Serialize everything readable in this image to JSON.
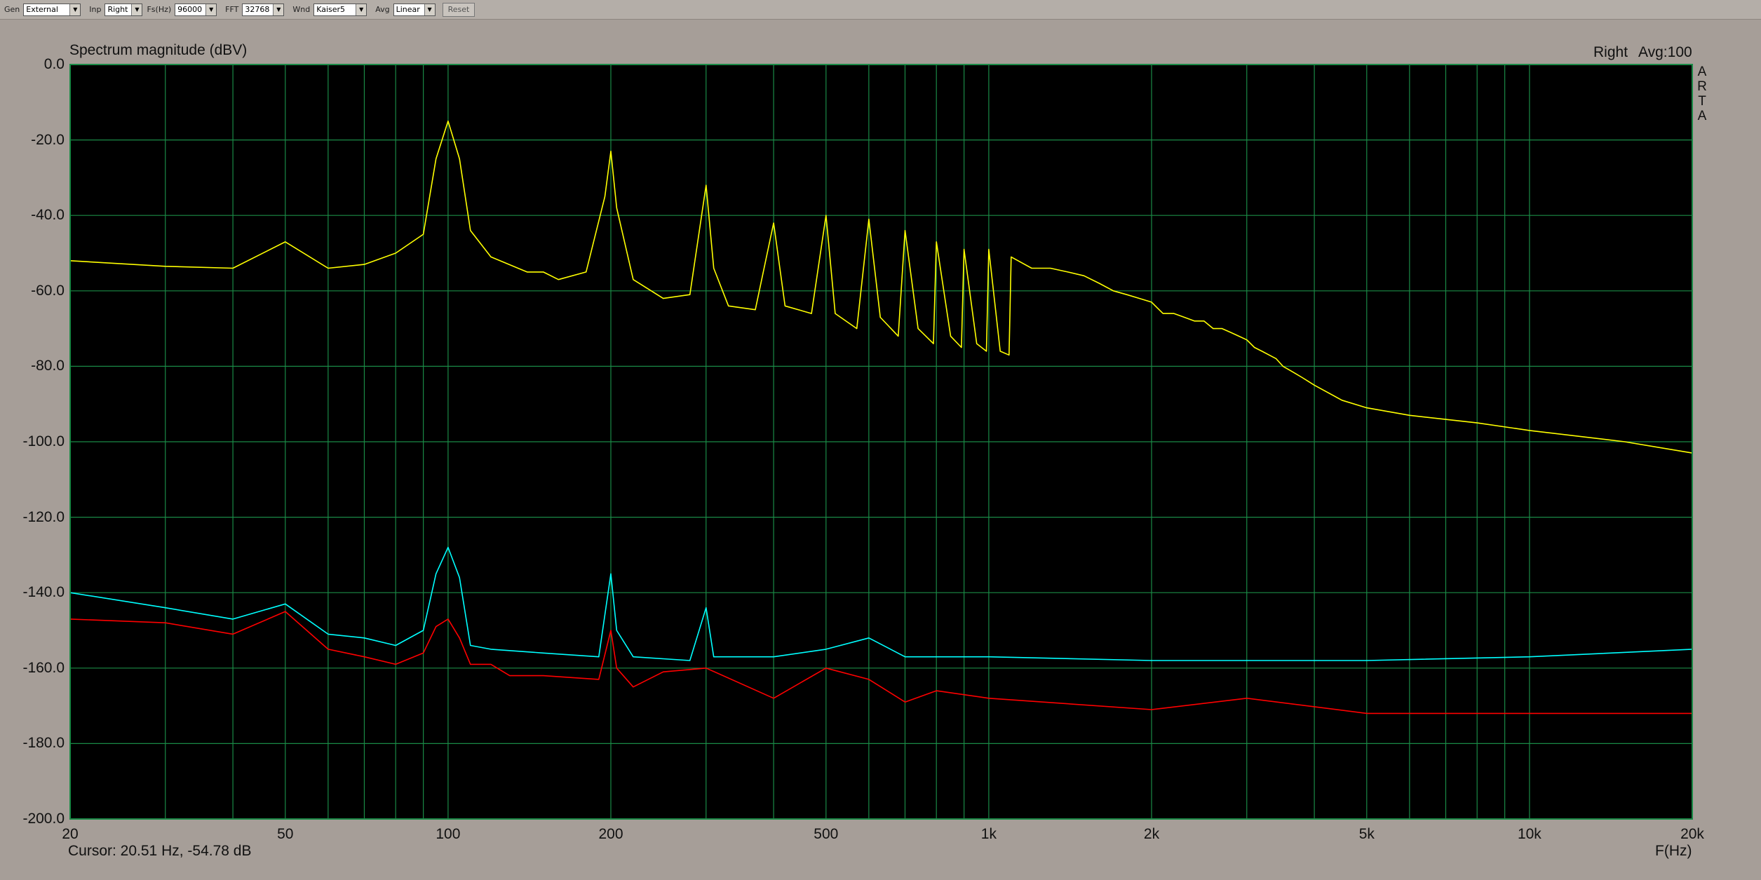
{
  "toolbar": {
    "gen": {
      "label": "Gen",
      "value": "External"
    },
    "inp": {
      "label": "Inp",
      "value": "Right"
    },
    "fs": {
      "label": "Fs(Hz)",
      "value": "96000"
    },
    "fft": {
      "label": "FFT",
      "value": "32768"
    },
    "wnd": {
      "label": "Wnd",
      "value": "Kaiser5"
    },
    "avg": {
      "label": "Avg",
      "value": "Linear"
    },
    "reset_label": "Reset"
  },
  "header": {
    "channel": "Right",
    "avg": "Avg:100",
    "watermark": [
      "A",
      "R",
      "T",
      "A"
    ]
  },
  "cursor_readout": "Cursor: 20.51 Hz, -54.78 dB",
  "colors": {
    "background": "#000000",
    "grid": "#1a8a46",
    "series1": "#ffff00",
    "series2": "#00ffff",
    "series3": "#ff0000"
  },
  "chart_data": {
    "type": "line",
    "title": "Spectrum magnitude (dBV)",
    "xlabel": "F(Hz)",
    "ylabel": "",
    "xscale": "log",
    "xlim": [
      20,
      20000
    ],
    "ylim": [
      -200,
      0
    ],
    "grid": true,
    "x_ticks": [
      20,
      50,
      100,
      200,
      500,
      1000,
      2000,
      5000,
      10000,
      20000
    ],
    "x_tick_labels": [
      "20",
      "50",
      "100",
      "200",
      "500",
      "1k",
      "2k",
      "5k",
      "10k",
      "20k"
    ],
    "y_ticks": [
      0,
      -20,
      -40,
      -60,
      -80,
      -100,
      -120,
      -140,
      -160,
      -180,
      -200
    ],
    "y_tick_labels": [
      "0.0",
      "-20.0",
      "-40.0",
      "-60.0",
      "-80.0",
      "-100.0",
      "-120.0",
      "-140.0",
      "-160.0",
      "-180.0",
      "-200.0"
    ],
    "series": [
      {
        "color": "#ffff00",
        "x": [
          20,
          30,
          40,
          50,
          60,
          70,
          80,
          90,
          95,
          100,
          105,
          110,
          120,
          140,
          150,
          160,
          180,
          195,
          200,
          205,
          220,
          250,
          280,
          300,
          310,
          330,
          370,
          400,
          420,
          470,
          500,
          520,
          570,
          600,
          630,
          680,
          700,
          740,
          790,
          800,
          850,
          890,
          900,
          950,
          990,
          1000,
          1050,
          1090,
          1100,
          1200,
          1300,
          1400,
          1500,
          1600,
          1700,
          1800,
          1900,
          2000,
          2100,
          2200,
          2300,
          2400,
          2500,
          2600,
          2700,
          2800,
          2900,
          3000,
          3100,
          3200,
          3300,
          3400,
          3500,
          3600,
          3700,
          3800,
          3900,
          4000,
          4500,
          5000,
          6000,
          8000,
          10000,
          15000,
          20000
        ],
        "y": [
          -52,
          -53.5,
          -54,
          -47,
          -54,
          -53,
          -50,
          -45,
          -25,
          -15,
          -25,
          -44,
          -51,
          -55,
          -55,
          -57,
          -55,
          -35,
          -23,
          -38,
          -57,
          -62,
          -61,
          -32,
          -54,
          -64,
          -65,
          -42,
          -64,
          -66,
          -40,
          -66,
          -70,
          -41,
          -67,
          -72,
          -44,
          -70,
          -74,
          -47,
          -72,
          -75,
          -49,
          -74,
          -76,
          -49,
          -76,
          -77,
          -51,
          -54,
          -54,
          -55,
          -56,
          -58,
          -60,
          -61,
          -62,
          -63,
          -66,
          -66,
          -67,
          -68,
          -68,
          -70,
          -70,
          -71,
          -72,
          -73,
          -75,
          -76,
          -77,
          -78,
          -80,
          -81,
          -82,
          -83,
          -84,
          -85,
          -89,
          -91,
          -93,
          -95,
          -97,
          -100,
          -103
        ]
      },
      {
        "color": "#00ffff",
        "x": [
          20,
          30,
          40,
          50,
          60,
          70,
          80,
          90,
          95,
          100,
          105,
          110,
          120,
          150,
          190,
          200,
          205,
          220,
          280,
          300,
          310,
          400,
          500,
          600,
          700,
          800,
          1000,
          2000,
          5000,
          10000,
          20000
        ],
        "y": [
          -140,
          -144,
          -147,
          -143,
          -151,
          -152,
          -154,
          -150,
          -135,
          -128,
          -136,
          -154,
          -155,
          -156,
          -157,
          -135,
          -150,
          -157,
          -158,
          -144,
          -157,
          -157,
          -155,
          -152,
          -157,
          -157,
          -157,
          -158,
          -158,
          -157,
          -155
        ]
      },
      {
        "color": "#ff0000",
        "x": [
          20,
          30,
          40,
          50,
          60,
          70,
          80,
          90,
          95,
          100,
          105,
          110,
          120,
          130,
          150,
          190,
          200,
          205,
          220,
          250,
          300,
          400,
          500,
          600,
          700,
          800,
          1000,
          2000,
          3000,
          5000,
          10000,
          20000
        ],
        "y": [
          -147,
          -148,
          -151,
          -145,
          -155,
          -157,
          -159,
          -156,
          -149,
          -147,
          -152,
          -159,
          -159,
          -162,
          -162,
          -163,
          -150,
          -160,
          -165,
          -161,
          -160,
          -168,
          -160,
          -163,
          -169,
          -166,
          -168,
          -171,
          -168,
          -172,
          -172,
          -172
        ]
      }
    ]
  }
}
